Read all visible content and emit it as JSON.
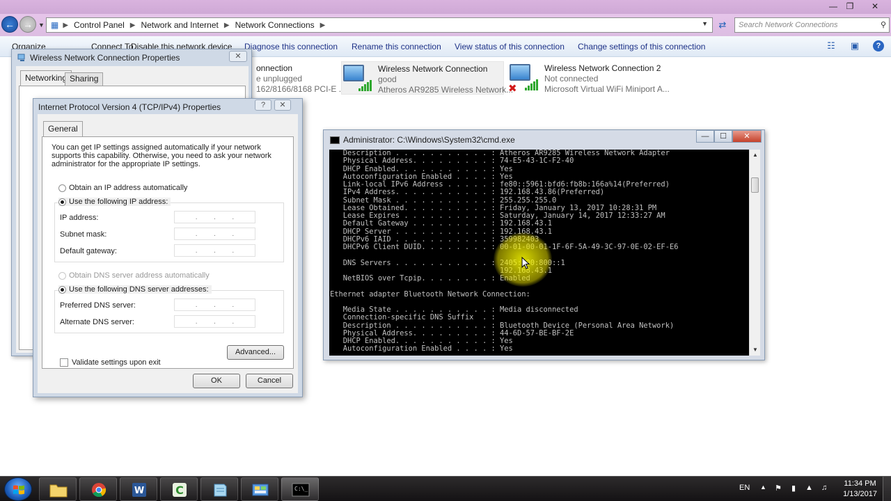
{
  "explorer": {
    "breadcrumb": [
      "Control Panel",
      "Network and Internet",
      "Network Connections"
    ],
    "search_placeholder": "Search Network Connections",
    "commands": {
      "organize": "Organize",
      "connect_to": "Connect To",
      "disable": "Disable this network device",
      "diagnose": "Diagnose this connection",
      "rename": "Rename this connection",
      "view_status": "View status of this connection",
      "change_settings": "Change settings of this connection"
    },
    "connections": [
      {
        "name": "onnection",
        "status": "e unplugged",
        "adapter": "162/8166/8168 PCI-E ..."
      },
      {
        "name": "Wireless Network Connection",
        "status": "good",
        "adapter": "Atheros AR9285 Wireless Network..."
      },
      {
        "name": "Wireless Network Connection 2",
        "status": "Not connected",
        "adapter": "Microsoft Virtual WiFi Miniport A..."
      }
    ]
  },
  "wireless_props": {
    "title": "Wireless Network Connection Properties",
    "tabs": [
      "Networking",
      "Sharing"
    ]
  },
  "ipv4": {
    "title": "Internet Protocol Version 4 (TCP/IPv4) Properties",
    "tab": "General",
    "intro": "You can get IP settings assigned automatically if your network supports this capability. Otherwise, you need to ask your network administrator for the appropriate IP settings.",
    "auto_ip": "Obtain an IP address automatically",
    "use_ip": "Use the following IP address:",
    "ip_address_label": "IP address:",
    "subnet_label": "Subnet mask:",
    "gateway_label": "Default gateway:",
    "auto_dns": "Obtain DNS server address automatically",
    "use_dns": "Use the following DNS server addresses:",
    "preferred_dns_label": "Preferred DNS server:",
    "alternate_dns_label": "Alternate DNS server:",
    "validate_label": "Validate settings upon exit",
    "advanced": "Advanced...",
    "ok": "OK",
    "cancel": "Cancel"
  },
  "cmd": {
    "title": "Administrator: C:\\Windows\\System32\\cmd.exe",
    "lines": [
      "   Description . . . . . . . . . . . : Atheros AR9285 Wireless Network Adapter",
      "   Physical Address. . . . . . . . . : 74-E5-43-1C-F2-40",
      "   DHCP Enabled. . . . . . . . . . . : Yes",
      "   Autoconfiguration Enabled . . . . : Yes",
      "   Link-local IPv6 Address . . . . . : fe80::5961:bfd6:fb8b:166a%14(Preferred)",
      "   IPv4 Address. . . . . . . . . . . : 192.168.43.86(Preferred)",
      "   Subnet Mask . . . . . . . . . . . : 255.255.255.0",
      "   Lease Obtained. . . . . . . . . . : Friday, January 13, 2017 10:28:31 PM",
      "   Lease Expires . . . . . . . . . . : Saturday, January 14, 2017 12:33:27 AM",
      "   Default Gateway . . . . . . . . . : 192.168.43.1",
      "   DHCP Server . . . . . . . . . . . : 192.168.43.1",
      "   DHCPv6 IAID . . . . . . . . . . . : 359982403",
      "   DHCPv6 Client DUID. . . . . . . . : 00-01-00-01-1F-6F-5A-49-3C-97-0E-02-EF-E6",
      "",
      "   DNS Servers . . . . . . . . . . . : 2405:200:800::1",
      "                                       192.168.43.1",
      "   NetBIOS over Tcpip. . . . . . . . : Enabled",
      "",
      "Ethernet adapter Bluetooth Network Connection:",
      "",
      "   Media State . . . . . . . . . . . : Media disconnected",
      "   Connection-specific DNS Suffix  . :",
      "   Description . . . . . . . . . . . : Bluetooth Device (Personal Area Network)",
      "   Physical Address. . . . . . . . . : 44-6D-57-BE-BF-2E",
      "   DHCP Enabled. . . . . . . . . . . : Yes",
      "   Autoconfiguration Enabled . . . . : Yes"
    ]
  },
  "taskbar": {
    "lang": "EN",
    "time": "11:34 PM",
    "date": "1/13/2017"
  }
}
